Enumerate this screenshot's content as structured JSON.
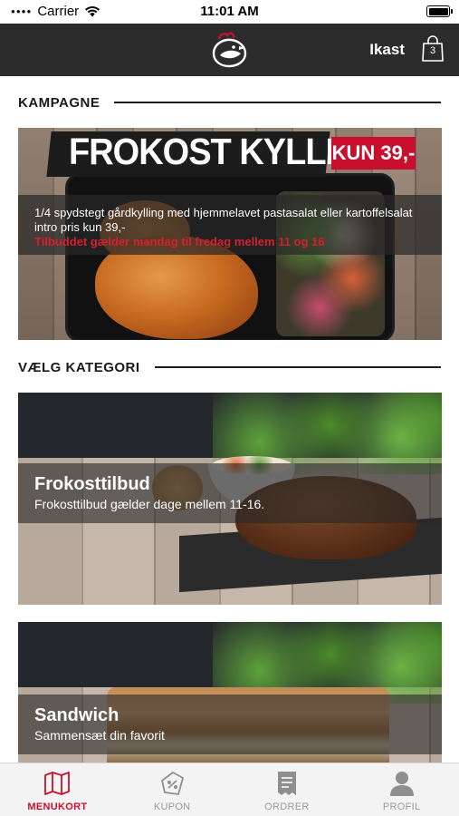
{
  "status_bar": {
    "carrier": "Carrier",
    "time": "11:01 AM"
  },
  "nav": {
    "cart_label": "Ikast",
    "cart_count": "3"
  },
  "sections": {
    "campaign_header": "KAMPAGNE",
    "category_header": "VÆLG KATEGORI"
  },
  "campaign": {
    "title": "FROKOST KYLLING",
    "price_badge": "KUN 39,-",
    "description": "1/4 spydstegt gårdkylling med hjemmelavet pastasalat eller kartoffelsalat intro pris kun 39,-",
    "note": "Tilbuddet gælder mandag til fredag mellem 11 og 16"
  },
  "categories": [
    {
      "name": "Frokosttilbud",
      "subtitle": "Frokosttilbud gælder dage mellem 11-16."
    },
    {
      "name": "Sandwich",
      "subtitle": "Sammensæt din favorit"
    }
  ],
  "tabs": [
    {
      "label": "MENUKORT",
      "icon": "map-icon",
      "active": true
    },
    {
      "label": "KUPON",
      "icon": "coupon-icon",
      "active": false
    },
    {
      "label": "ORDRER",
      "icon": "receipt-icon",
      "active": false
    },
    {
      "label": "PROFIL",
      "icon": "person-icon",
      "active": false
    }
  ],
  "colors": {
    "accent": "#c8102e",
    "navbar": "#2c2c2c",
    "tab_inactive": "#9a9a9a"
  }
}
